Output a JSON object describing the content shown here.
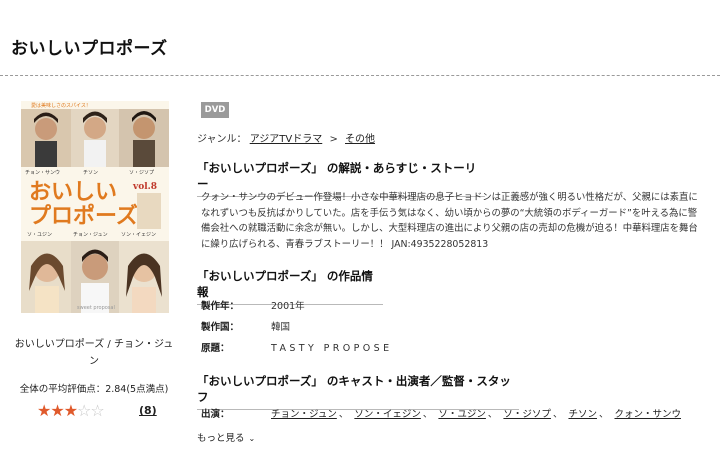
{
  "page": {
    "title": "おいしいプロポーズ"
  },
  "cover": {
    "series_title": "おいしい\nプロポーズ",
    "volume": "vol.8",
    "cast_top": [
      "チョン・サンウ",
      "チソン",
      "ソ・ジソプ"
    ],
    "cast_bottom": [
      "ソ・ユジン",
      "チョン・ジュン",
      "ソン・イェジン"
    ],
    "tagline_bottom": "sweet proposal",
    "bg_color": "#fbf6ea",
    "title_color": "#e07a1f",
    "logo_color": "#f0a020"
  },
  "item": {
    "title": "おいしいプロポーズ / チョン・ジュン",
    "rating_text": "全体の平均評価点：2.84(5点満点)",
    "rating_value": 2.84,
    "rating_max": 5,
    "rating_count": "(8)"
  },
  "detail": {
    "format_badge": "DVD",
    "genre_label": "ジャンル：",
    "genre_links": [
      "アジアTVドラマ",
      "その他"
    ],
    "genre_sep": ">",
    "synopsis_heading": "「おいしいプロポーズ」 の解説・あらすじ・ストーリー",
    "synopsis": "クォン・サンウのデビュー作登場！小さな中華料理店の息子ヒョドンは正義感が強く明るい性格だが、父親には素直になれずいつも反抗ばかりしていた。店を手伝う気はなく、幼い頃からの夢の“大統領のボディーガード”を叶える為に警備会社への就職活動に余念が無い。しかし、大型料理店の進出により父親の店の売却の危機が迫る！中華料理店を舞台に繰り広げられる、青春ラブストーリー！！ JAN:4935228052813",
    "info_heading": "「おいしいプロポーズ」 の作品情報",
    "info_rows": [
      {
        "label": "製作年：",
        "value": "2001年"
      },
      {
        "label": "製作国：",
        "value": "韓国"
      },
      {
        "label": "原題：",
        "value": "TASTY PROPOSE"
      }
    ],
    "cast_heading": "「おいしいプロポーズ」 のキャスト・出演者／監督・スタッフ",
    "cast_label": "出演：",
    "cast_names": [
      "チョン・ジュン",
      "ソン・イェジン",
      "ソ・ユジン",
      "ソ・ジソプ",
      "チソン",
      "クォン・サンウ"
    ],
    "cast_sep": "、",
    "more_label": "もっと見る"
  },
  "colors": {
    "star_on": "#e05a2c",
    "star_off": "#c8c8c8",
    "badge": "#9a9a9a"
  }
}
